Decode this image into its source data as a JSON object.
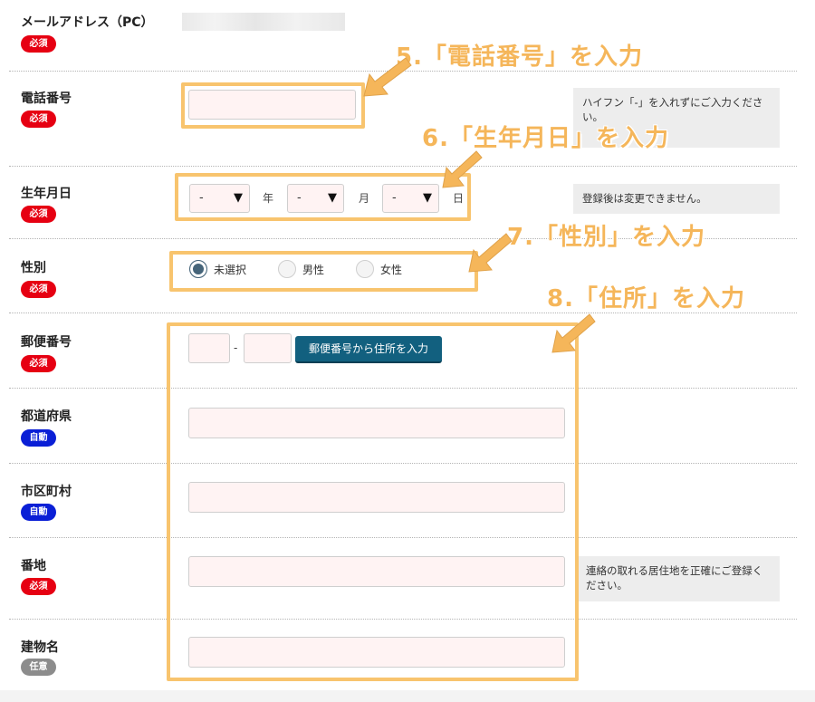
{
  "rows": {
    "email": {
      "label": "メールアドレス（PC）",
      "badge": "必須"
    },
    "phone": {
      "label": "電話番号",
      "badge": "必須",
      "note": "ハイフン「-」を入れずにご入力ください。"
    },
    "birth": {
      "label": "生年月日",
      "badge": "必須",
      "note": "登録後は変更できません。",
      "year_value": "-",
      "month_value": "-",
      "day_value": "-",
      "year_unit": "年",
      "month_unit": "月",
      "day_unit": "日"
    },
    "gender": {
      "label": "性別",
      "badge": "必須",
      "options": [
        "未選択",
        "男性",
        "女性"
      ],
      "selected": "未選択"
    },
    "zip": {
      "label": "郵便番号",
      "badge": "必須",
      "separator": "-",
      "button": "郵便番号から住所を入力"
    },
    "prefecture": {
      "label": "都道府県",
      "badge": "自動"
    },
    "city": {
      "label": "市区町村",
      "badge": "自動"
    },
    "street": {
      "label": "番地",
      "badge": "必須",
      "note": "連絡の取れる居住地を正確にご登録ください。"
    },
    "building": {
      "label": "建物名",
      "badge": "任意"
    }
  },
  "callouts": {
    "phone": "5.「電話番号」を入力",
    "birth": "6.「生年月日」を入力",
    "gender": "7.「性別」を入力",
    "address": "8.「住所」を入力"
  },
  "colors": {
    "required": "#e60012",
    "auto": "#0a1fd6",
    "optional": "#8c8c8c",
    "highlight": "#f8c46e",
    "button": "#12607f",
    "input_bg": "#fff3f3"
  }
}
